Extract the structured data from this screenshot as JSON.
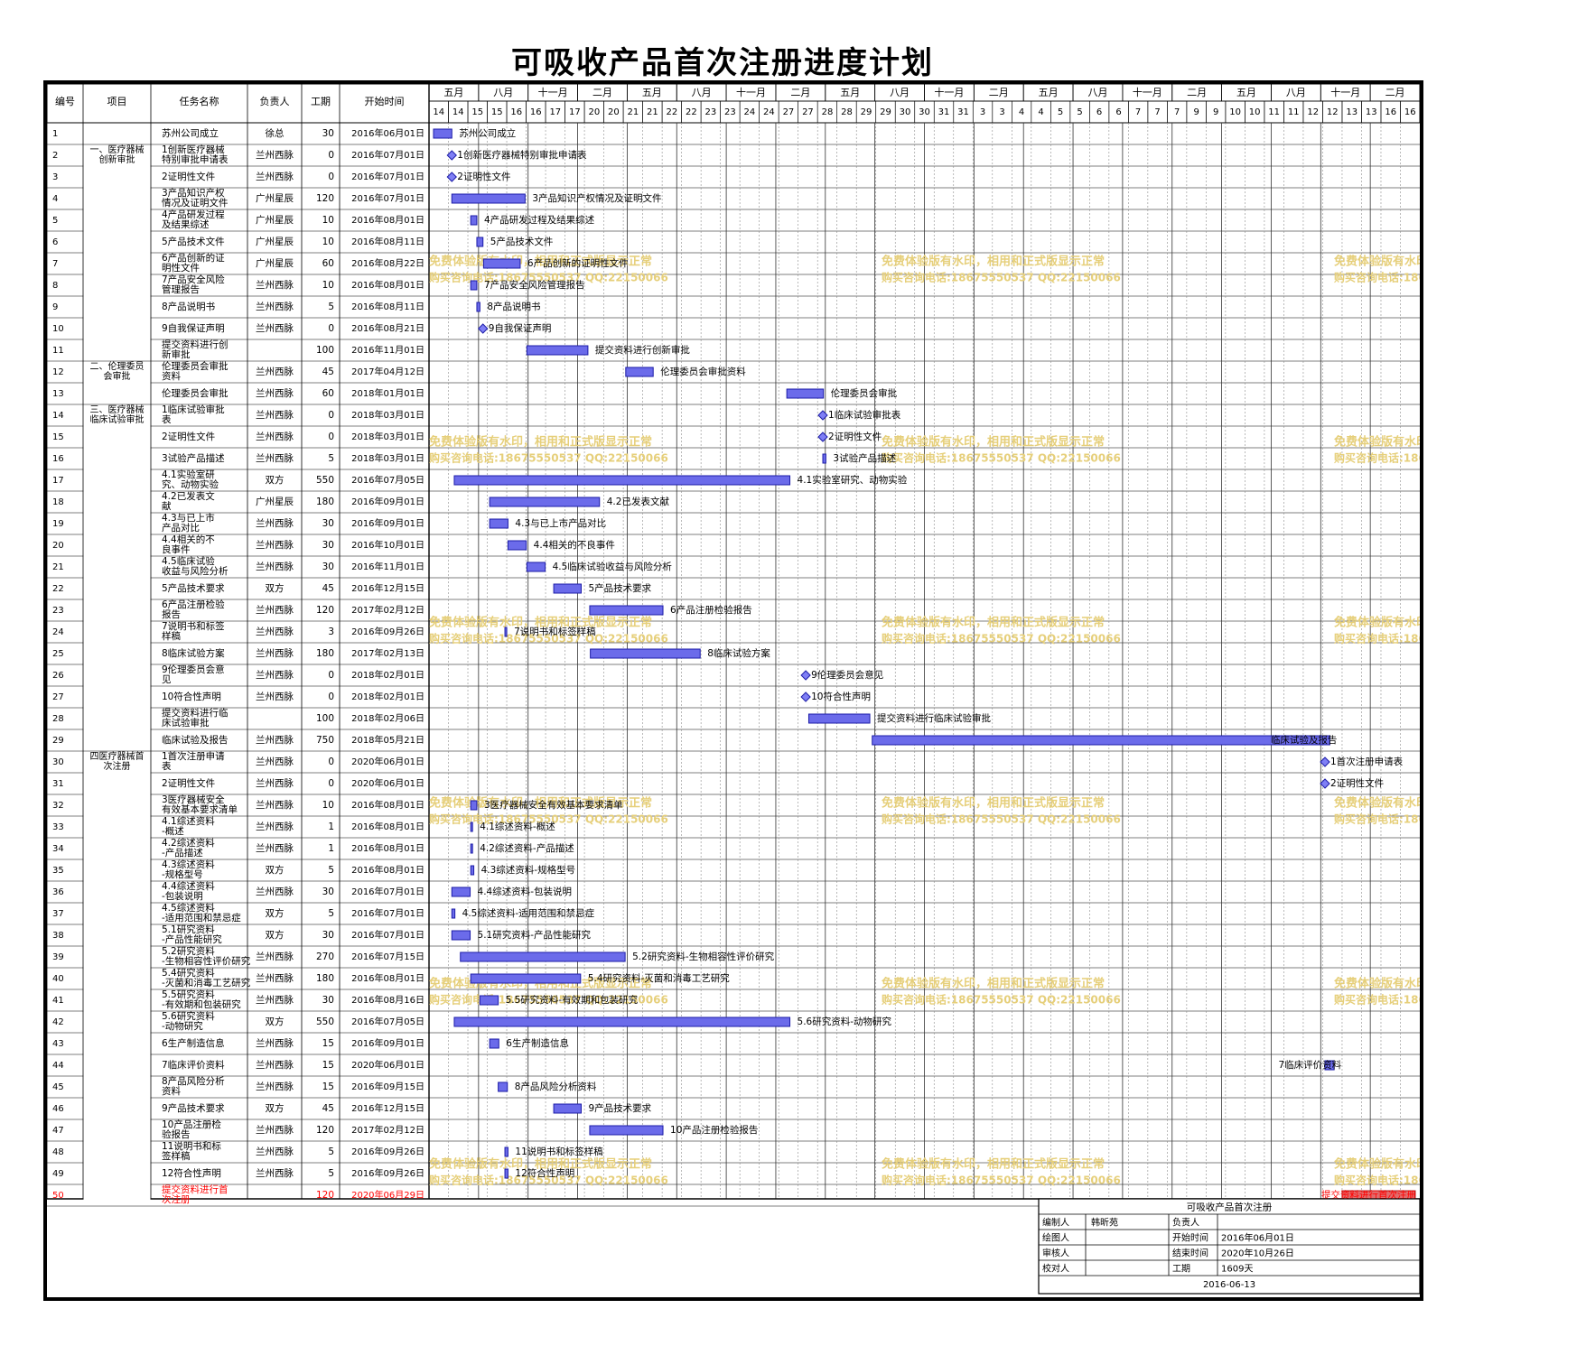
{
  "title": "可吸收产品首次注册进度计划",
  "headers": {
    "num": "编号",
    "project": "项目",
    "task": "任务名称",
    "owner": "负责人",
    "duration": "工期",
    "start": "开始时间"
  },
  "timeline": {
    "seasons": [
      "五月",
      "八月",
      "十一月",
      "二月",
      "五月",
      "八月",
      "十一月",
      "二月",
      "五月",
      "八月",
      "十一月",
      "二月",
      "五月",
      "八月",
      "十一月",
      "二月",
      "五月",
      "八月",
      "十一月",
      "二月"
    ],
    "days": [
      "14",
      "14",
      "15",
      "15",
      "16",
      "16",
      "17",
      "17",
      "20",
      "20",
      "21",
      "21",
      "22",
      "22",
      "23",
      "23",
      "24",
      "24",
      "27",
      "27",
      "28",
      "28",
      "29",
      "29",
      "30",
      "30",
      "31",
      "31",
      "3",
      "3",
      "4",
      "4",
      "5",
      "5",
      "6",
      "6",
      "7",
      "7",
      "7",
      "9",
      "9",
      "10",
      "10",
      "11",
      "11",
      "12",
      "12",
      "13",
      "13",
      "16",
      "16"
    ],
    "start_date": "2016-06-01"
  },
  "groups": [
    {
      "label": "一、医疗器械\n创新审批",
      "first": 1,
      "last": 10
    },
    {
      "label": "二、伦理委员\n会审批",
      "first": 11,
      "last": 12
    },
    {
      "label": "三、医疗器械\n临床试验审批",
      "first": 13,
      "last": 28
    },
    {
      "label": "四医疗器械首\n次注册",
      "first": 29,
      "last": 49
    }
  ],
  "chart_data": {
    "type": "gantt",
    "title": "可吸收产品首次注册进度计划",
    "tasks": [
      {
        "id": "1",
        "name": "苏州公司成立",
        "owner": "徐总",
        "duration": 30,
        "start": "2016年06月01日",
        "bar_label": "苏州公司成立"
      },
      {
        "id": "2",
        "name": "1创新医疗器械特别审批申请表",
        "owner": "兰州西脉",
        "duration": 0,
        "start": "2016年07月01日",
        "bar_label": "1创新医疗器械特别审批申请表"
      },
      {
        "id": "3",
        "name": "2证明性文件",
        "owner": "兰州西脉",
        "duration": 0,
        "start": "2016年07月01日",
        "bar_label": "2证明性文件"
      },
      {
        "id": "4",
        "name": "3产品知识产权情况及证明文件",
        "owner": "广州星辰",
        "duration": 120,
        "start": "2016年07月01日",
        "bar_label": "3产品知识产权情况及证明文件"
      },
      {
        "id": "5",
        "name": "4产品研发过程及结果综述",
        "owner": "广州星辰",
        "duration": 10,
        "start": "2016年08月01日",
        "bar_label": "4产品研发过程及结果综述"
      },
      {
        "id": "6",
        "name": "5产品技术文件",
        "owner": "广州星辰",
        "duration": 10,
        "start": "2016年08月11日",
        "bar_label": "5产品技术文件"
      },
      {
        "id": "7",
        "name": "6产品创新的证明性文件",
        "owner": "广州星辰",
        "duration": 60,
        "start": "2016年08月22日",
        "bar_label": "6产品创新的证明性文件"
      },
      {
        "id": "8",
        "name": "7产品安全风险管理报告",
        "owner": "兰州西脉",
        "duration": 10,
        "start": "2016年08月01日",
        "bar_label": "7产品安全风险管理报告"
      },
      {
        "id": "9",
        "name": "8产品说明书",
        "owner": "兰州西脉",
        "duration": 5,
        "start": "2016年08月11日",
        "bar_label": "8产品说明书"
      },
      {
        "id": "10",
        "name": "9自我保证声明",
        "owner": "兰州西脉",
        "duration": 0,
        "start": "2016年08月21日",
        "bar_label": "9自我保证声明"
      },
      {
        "id": "11",
        "name": "提交资料进行创新审批",
        "owner": "",
        "duration": 100,
        "start": "2016年11月01日",
        "bar_label": "提交资料进行创新审批"
      },
      {
        "id": "12",
        "name": "伦理委员会审批资料",
        "owner": "兰州西脉",
        "duration": 45,
        "start": "2017年04月12日",
        "bar_label": "伦理委员会审批资料"
      },
      {
        "id": "13",
        "name": "伦理委员会审批",
        "owner": "兰州西脉",
        "duration": 60,
        "start": "2018年01月01日",
        "bar_label": "伦理委员会审批"
      },
      {
        "id": "14",
        "name": "1临床试验审批表",
        "owner": "兰州西脉",
        "duration": 0,
        "start": "2018年03月01日",
        "bar_label": "1临床试验审批表"
      },
      {
        "id": "15",
        "name": "2证明性文件",
        "owner": "兰州西脉",
        "duration": 0,
        "start": "2018年03月01日",
        "bar_label": "2证明性文件"
      },
      {
        "id": "16",
        "name": "3试验产品描述",
        "owner": "兰州西脉",
        "duration": 5,
        "start": "2018年03月01日",
        "bar_label": "3试验产品描述"
      },
      {
        "id": "17",
        "name": "4.1实验室研究、动物实验",
        "owner": "双方",
        "duration": 550,
        "start": "2016年07月05日",
        "bar_label": "4.1实验室研究、动物实验"
      },
      {
        "id": "18",
        "name": "4.2已发表文献",
        "owner": "广州星辰",
        "duration": 180,
        "start": "2016年09月01日",
        "bar_label": "4.2已发表文献"
      },
      {
        "id": "19",
        "name": "4.3与已上市产品对比",
        "owner": "兰州西脉",
        "duration": 30,
        "start": "2016年09月01日",
        "bar_label": "4.3与已上市产品对比"
      },
      {
        "id": "20",
        "name": "4.4相关的不良事件",
        "owner": "兰州西脉",
        "duration": 30,
        "start": "2016年10月01日",
        "bar_label": "4.4相关的不良事件"
      },
      {
        "id": "21",
        "name": "4.5临床试验收益与风险分析",
        "owner": "兰州西脉",
        "duration": 30,
        "start": "2016年11月01日",
        "bar_label": "4.5临床试验收益与风险分析"
      },
      {
        "id": "22",
        "name": "5产品技术要求",
        "owner": "双方",
        "duration": 45,
        "start": "2016年12月15日",
        "bar_label": "5产品技术要求"
      },
      {
        "id": "23",
        "name": "6产品注册检验报告",
        "owner": "兰州西脉",
        "duration": 120,
        "start": "2017年02月12日",
        "bar_label": "6产品注册检验报告"
      },
      {
        "id": "24",
        "name": "7说明书和标签样稿",
        "owner": "兰州西脉",
        "duration": 3,
        "start": "2016年09月26日",
        "bar_label": "7说明书和标签样稿"
      },
      {
        "id": "25",
        "name": "8临床试验方案",
        "owner": "兰州西脉",
        "duration": 180,
        "start": "2017年02月13日",
        "bar_label": "8临床试验方案"
      },
      {
        "id": "26",
        "name": "9伦理委员会意见",
        "owner": "兰州西脉",
        "duration": 0,
        "start": "2018年02月01日",
        "bar_label": "9伦理委员会意见"
      },
      {
        "id": "27",
        "name": "10符合性声明",
        "owner": "兰州西脉",
        "duration": 0,
        "start": "2018年02月01日",
        "bar_label": "10符合性声明"
      },
      {
        "id": "28",
        "name": "提交资料进行临床试验审批",
        "owner": "",
        "duration": 100,
        "start": "2018年02月06日",
        "bar_label": "提交资料进行临床试验审批"
      },
      {
        "id": "29",
        "name": "临床试验及报告",
        "owner": "兰州西脉",
        "duration": 750,
        "start": "2018年05月21日",
        "bar_label": "临床试验及报告"
      },
      {
        "id": "30",
        "name": "1首次注册申请表",
        "owner": "兰州西脉",
        "duration": 0,
        "start": "2020年06月01日",
        "bar_label": "1首次注册申请表"
      },
      {
        "id": "31",
        "name": "2证明性文件",
        "owner": "兰州西脉",
        "duration": 0,
        "start": "2020年06月01日",
        "bar_label": "2证明性文件"
      },
      {
        "id": "32",
        "name": "3医疗器械安全有效基本要求清单",
        "owner": "兰州西脉",
        "duration": 10,
        "start": "2016年08月01日",
        "bar_label": "3医疗器械安全有效基本要求清单"
      },
      {
        "id": "33",
        "name": "4.1综述资料-概述",
        "owner": "兰州西脉",
        "duration": 1,
        "start": "2016年08月01日",
        "bar_label": "4.1综述资料-概述"
      },
      {
        "id": "34",
        "name": "4.2综述资料-产品描述",
        "owner": "兰州西脉",
        "duration": 1,
        "start": "2016年08月01日",
        "bar_label": "4.2综述资料-产品描述"
      },
      {
        "id": "35",
        "name": "4.3综述资料-规格型号",
        "owner": "双方",
        "duration": 5,
        "start": "2016年08月01日",
        "bar_label": "4.3综述资料-规格型号"
      },
      {
        "id": "36",
        "name": "4.4综述资料-包装说明",
        "owner": "兰州西脉",
        "duration": 30,
        "start": "2016年07月01日",
        "bar_label": "4.4综述资料-包装说明"
      },
      {
        "id": "37",
        "name": "4.5综述资料-适用范围和禁忌症",
        "owner": "双方",
        "duration": 5,
        "start": "2016年07月01日",
        "bar_label": "4.5综述资料-适用范围和禁忌症"
      },
      {
        "id": "38",
        "name": "5.1研究资料-产品性能研究",
        "owner": "双方",
        "duration": 30,
        "start": "2016年07月01日",
        "bar_label": "5.1研究资料-产品性能研究"
      },
      {
        "id": "39",
        "name": "5.2研究资料-生物相容性评价研究",
        "owner": "兰州西脉",
        "duration": 270,
        "start": "2016年07月15日",
        "bar_label": "5.2研究资料-生物相容性评价研究"
      },
      {
        "id": "40",
        "name": "5.4研究资料-灭菌和消毒工艺研究",
        "owner": "兰州西脉",
        "duration": 180,
        "start": "2016年08月01日",
        "bar_label": "5.4研究资料-灭菌和消毒工艺研究"
      },
      {
        "id": "41",
        "name": "5.5研究资料-有效期和包装研究",
        "owner": "兰州西脉",
        "duration": 30,
        "start": "2016年08月16日",
        "bar_label": "5.5研究资料-有效期和包装研究"
      },
      {
        "id": "42",
        "name": "5.6研究资料-动物研究",
        "owner": "双方",
        "duration": 550,
        "start": "2016年07月05日",
        "bar_label": "5.6研究资料-动物研究"
      },
      {
        "id": "43",
        "name": "6生产制造信息",
        "owner": "兰州西脉",
        "duration": 15,
        "start": "2016年09月01日",
        "bar_label": "6生产制造信息"
      },
      {
        "id": "44",
        "name": "7临床评价资料",
        "owner": "兰州西脉",
        "duration": 15,
        "start": "2020年06月01日",
        "bar_label": "7临床评价资料"
      },
      {
        "id": "45",
        "name": "8产品风险分析资料",
        "owner": "兰州西脉",
        "duration": 15,
        "start": "2016年09月15日",
        "bar_label": "8产品风险分析资料"
      },
      {
        "id": "46",
        "name": "9产品技术要求",
        "owner": "双方",
        "duration": 45,
        "start": "2016年12月15日",
        "bar_label": "9产品技术要求"
      },
      {
        "id": "47",
        "name": "10产品注册检验报告",
        "owner": "兰州西脉",
        "duration": 120,
        "start": "2017年02月12日",
        "bar_label": "10产品注册检验报告"
      },
      {
        "id": "48",
        "name": "11说明书和标签样稿",
        "owner": "兰州西脉",
        "duration": 5,
        "start": "2016年09月26日",
        "bar_label": "11说明书和标签样稿"
      },
      {
        "id": "49",
        "name": "12符合性声明",
        "owner": "兰州西脉",
        "duration": 5,
        "start": "2016年09月26日",
        "bar_label": "12符合性声明"
      },
      {
        "id": "50",
        "name": "提交资料进行首次注册",
        "owner": "",
        "duration": 120,
        "start": "2020年06月29日",
        "bar_label": "提交资料进行首次注册",
        "highlight": true
      }
    ]
  },
  "watermark": {
    "line1": "免费体验版有水印，相用和正式版显示正常",
    "line2": "购买咨询电话:18675550537 QQ:22150066"
  },
  "info": {
    "project_name": "可吸收产品首次注册",
    "editor_label": "编制人",
    "editor": "韩昕苑",
    "owner_label": "负责人",
    "owner": "",
    "drawer_label": "绘图人",
    "drawer": "",
    "start_label": "开始时间",
    "start": "2016年06月01日",
    "reviewer_label": "审核人",
    "reviewer": "",
    "end_label": "结束时间",
    "end": "2020年10月26日",
    "checker_label": "校对人",
    "checker": "",
    "duration_label": "工期",
    "duration": "1609天",
    "date": "2016-06-13"
  },
  "colors": {
    "bar_fill": "#6b6bea",
    "bar_stroke": "#1c1ca8",
    "milestone_fill": "#7f7ff5",
    "highlight": "#e26a6a",
    "highlight_text": "#ff0000",
    "watermark": "#e6cf7a",
    "grid": "#8c8c8c"
  }
}
